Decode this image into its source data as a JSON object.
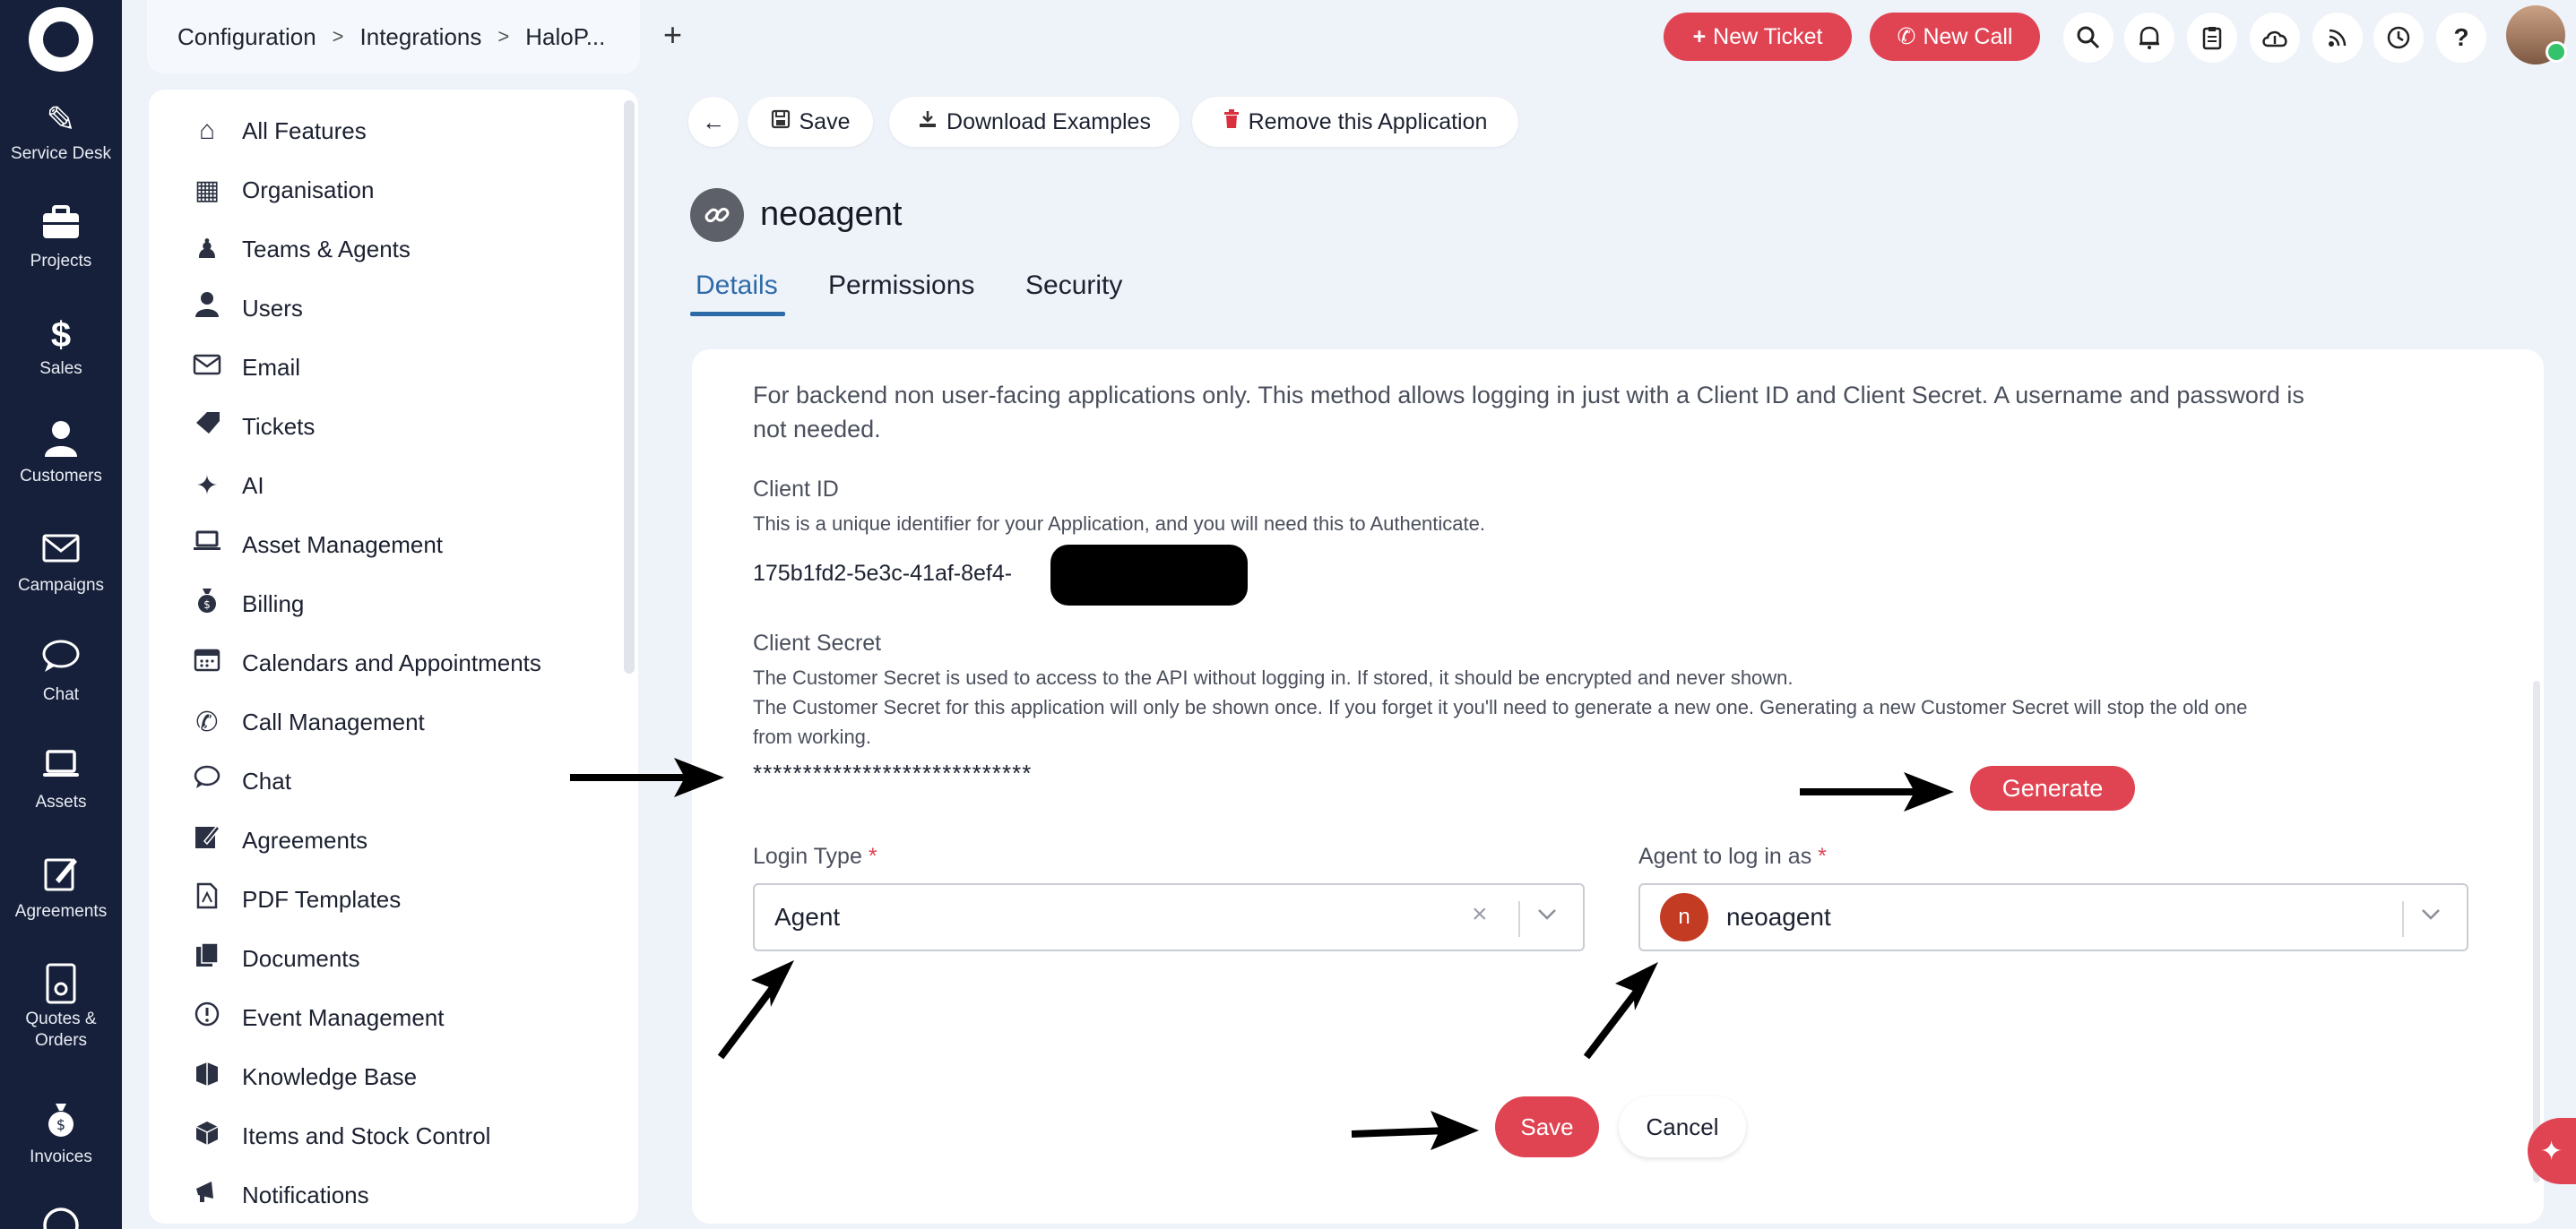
{
  "leftnav": {
    "items": [
      {
        "label": "Service Desk",
        "icon": "ticket-icon"
      },
      {
        "label": "Projects",
        "icon": "briefcase-icon"
      },
      {
        "label": "Sales",
        "icon": "dollar-icon"
      },
      {
        "label": "Customers",
        "icon": "user-icon"
      },
      {
        "label": "Campaigns",
        "icon": "envelope-icon"
      },
      {
        "label": "Chat",
        "icon": "chat-icon"
      },
      {
        "label": "Assets",
        "icon": "laptop-icon"
      },
      {
        "label": "Agreements",
        "icon": "pen-icon"
      },
      {
        "label": "Quotes &",
        "label2": "Orders",
        "icon": "document-icon"
      },
      {
        "label": "Invoices",
        "icon": "money-bag-icon"
      }
    ]
  },
  "header": {
    "breadcrumb": [
      "Configuration",
      "Integrations",
      "HaloP..."
    ],
    "new_ticket": "New Ticket",
    "new_call": "New Call"
  },
  "settings": {
    "items": [
      {
        "label": "All Features",
        "icon": "home-icon"
      },
      {
        "label": "Organisation",
        "icon": "building-icon"
      },
      {
        "label": "Teams & Agents",
        "icon": "agent-icon"
      },
      {
        "label": "Users",
        "icon": "user-icon"
      },
      {
        "label": "Email",
        "icon": "email-icon"
      },
      {
        "label": "Tickets",
        "icon": "ticket-icon"
      },
      {
        "label": "AI",
        "icon": "sparkle-icon"
      },
      {
        "label": "Asset Management",
        "icon": "laptop-icon"
      },
      {
        "label": "Billing",
        "icon": "money-bag-icon"
      },
      {
        "label": "Calendars and Appointments",
        "icon": "calendar-icon"
      },
      {
        "label": "Call Management",
        "icon": "phone-icon"
      },
      {
        "label": "Chat",
        "icon": "chat-icon"
      },
      {
        "label": "Agreements",
        "icon": "pen-icon"
      },
      {
        "label": "PDF Templates",
        "icon": "pdf-icon"
      },
      {
        "label": "Documents",
        "icon": "documents-icon"
      },
      {
        "label": "Event Management",
        "icon": "alert-icon"
      },
      {
        "label": "Knowledge Base",
        "icon": "books-icon"
      },
      {
        "label": "Items and Stock Control",
        "icon": "boxes-icon"
      },
      {
        "label": "Notifications",
        "icon": "megaphone-icon"
      }
    ]
  },
  "toolbar": {
    "save": "Save",
    "download": "Download Examples",
    "remove": "Remove this Application"
  },
  "app": {
    "name": "neoagent"
  },
  "tabs": [
    "Details",
    "Permissions",
    "Security"
  ],
  "details": {
    "intro_line1": "For backend non user-facing applications only. This method allows logging in just with a Client ID and Client Secret. A username and password is",
    "intro_line2": "not needed.",
    "client_id_title": "Client ID",
    "client_id_help": "This is a unique identifier for your Application, and you will need this to Authenticate.",
    "client_id_value": "175b1fd2-5e3c-41af-8ef4-",
    "client_secret_title": "Client Secret",
    "client_secret_help1": "The Customer Secret is used to access to the API without logging in. If stored, it should be encrypted and never shown.",
    "client_secret_help2": "The Customer Secret for this application will only be shown once. If you forget it you'll need to generate a new one. Generating a new Customer Secret will stop the old one",
    "client_secret_help3": "from working.",
    "client_secret_value": "****************************",
    "generate": "Generate",
    "login_type_label": "Login Type",
    "login_type_value": "Agent",
    "agent_label": "Agent to log in as",
    "agent_initial": "n",
    "agent_value": "neoagent",
    "required_mark": "*",
    "save": "Save",
    "cancel": "Cancel"
  },
  "colors": {
    "accent": "#e04453",
    "nav_bg": "#16203a",
    "tab_active": "#2f6aa8"
  }
}
